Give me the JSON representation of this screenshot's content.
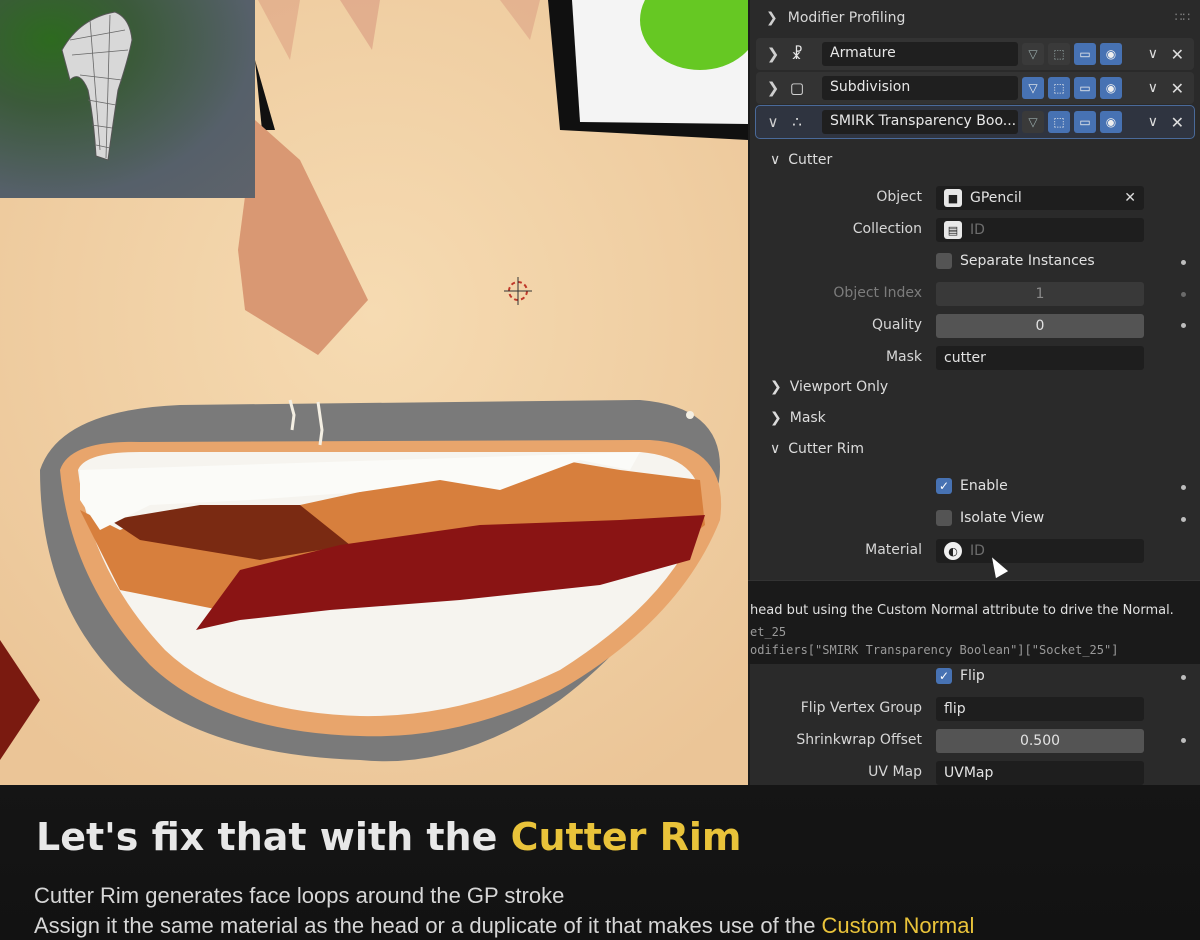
{
  "panel": {
    "modifier_profiling": "Modifier Profiling",
    "modifiers": [
      {
        "name": "Armature",
        "icon": "armature-icon"
      },
      {
        "name": "Subdivision",
        "icon": "subdivision-icon"
      },
      {
        "name": "SMIRK Transparency Boo...",
        "icon": "geometry-nodes-icon"
      }
    ],
    "cutter": {
      "header": "Cutter",
      "object_label": "Object",
      "object_value": "GPencil",
      "collection_label": "Collection",
      "collection_placeholder": "ID",
      "separate_instances": "Separate Instances",
      "object_index_label": "Object Index",
      "object_index_value": "1",
      "quality_label": "Quality",
      "quality_value": "0",
      "mask_label": "Mask",
      "mask_value": "cutter"
    },
    "viewport_only": "Viewport Only",
    "mask_section": "Mask",
    "cutter_rim": {
      "header": "Cutter Rim",
      "enable": "Enable",
      "enable_checked": true,
      "isolate_view": "Isolate View",
      "isolate_checked": false,
      "material_label": "Material",
      "material_placeholder": "ID",
      "flip": "Flip",
      "flip_checked": true,
      "flip_vertex_group_label": "Flip Vertex Group",
      "flip_vertex_group_value": "flip",
      "shrinkwrap_offset_label": "Shrinkwrap Offset",
      "shrinkwrap_offset_value": "0.500",
      "uv_map_label": "UV Map",
      "uv_map_value": "UVMap"
    }
  },
  "tooltip": {
    "line1": "head but using the Custom Normal attribute to drive the Normal.",
    "line2": "et_25",
    "line3": "odifiers[\"SMIRK Transparency Boolean\"][\"Socket_25\"]"
  },
  "caption": {
    "headline_prefix": "Let's fix that with the ",
    "headline_highlight": "Cutter Rim",
    "line1": "Cutter Rim generates face loops around the GP stroke",
    "line2_prefix": "Assign it the same material as the head or a duplicate of it that makes use of the ",
    "line2_highlight": "Custom Normal"
  },
  "colors": {
    "accent_blue": "#4772b3",
    "highlight_yellow": "#e9c33a",
    "skin": "#f1d2a6",
    "mouth_outline": "#7a7a7a",
    "tongue": "#8a1414"
  }
}
